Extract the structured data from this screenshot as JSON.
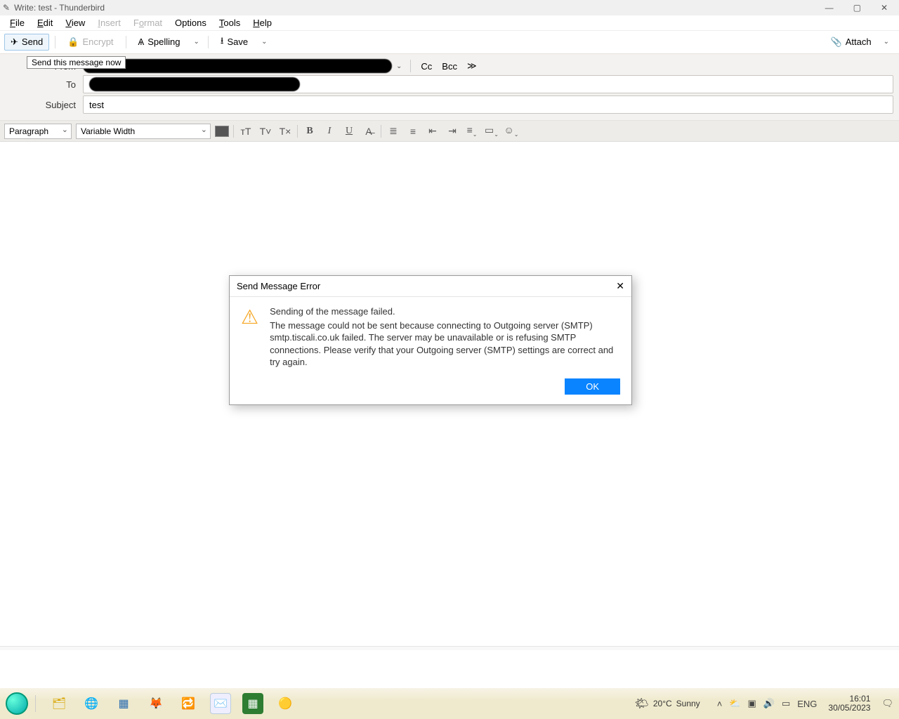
{
  "title": "Write: test - Thunderbird",
  "menu": {
    "file": "File",
    "edit": "Edit",
    "view": "View",
    "insert": "Insert",
    "format": "Format",
    "options": "Options",
    "tools": "Tools",
    "help": "Help"
  },
  "toolbar": {
    "send": "Send",
    "encrypt": "Encrypt",
    "spelling": "Spelling",
    "save": "Save",
    "attach": "Attach"
  },
  "tooltip": "Send this message now",
  "headers": {
    "from_label": "From",
    "to_label": "To",
    "subject_label": "Subject",
    "subject_value": "test",
    "cc": "Cc",
    "bcc": "Bcc"
  },
  "format": {
    "para": "Paragraph",
    "font": "Variable Width"
  },
  "dialog": {
    "title": "Send Message Error",
    "line1": "Sending of the message failed.",
    "line2": "The message could not be sent because connecting to Outgoing server (SMTP) smtp.tiscali.co.uk failed. The server may be unavailable or is refusing SMTP connections. Please verify that your Outgoing server (SMTP) settings are correct and try again.",
    "ok": "OK"
  },
  "taskbar": {
    "weather_temp": "20°C",
    "weather_cond": "Sunny",
    "lang": "ENG",
    "time": "16:01",
    "date": "30/05/2023"
  }
}
